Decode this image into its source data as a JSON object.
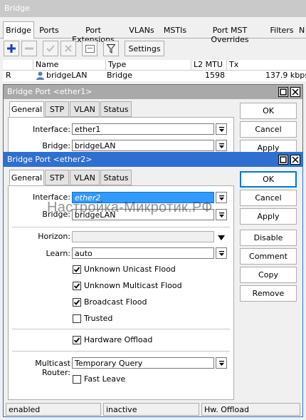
{
  "window": {
    "title": "Bridge"
  },
  "tabs": [
    "Bridge",
    "Ports",
    "Port Extensions",
    "VLANs",
    "MSTIs",
    "Port MST Overrides",
    "Filters",
    "N"
  ],
  "toolbar": {
    "settings_label": "Settings"
  },
  "table": {
    "headers": [
      "",
      "Name",
      "Type",
      "L2 MTU",
      "Tx"
    ],
    "rows": [
      {
        "flag": "R",
        "name": "bridgeLAN",
        "type": "Bridge",
        "l2mtu": "1598",
        "tx": "137.9 kbps"
      }
    ]
  },
  "dialog1": {
    "title": "Bridge Port <ether1>",
    "tabs": [
      "General",
      "STP",
      "VLAN",
      "Status"
    ],
    "interface_label": "Interface:",
    "interface_value": "ether1",
    "bridge_label": "Bridge:",
    "bridge_value": "bridgeLAN",
    "buttons": [
      "OK",
      "Cancel",
      "Apply"
    ]
  },
  "dialog2": {
    "title": "Bridge Port <ether2>",
    "tabs": [
      "General",
      "STP",
      "VLAN",
      "Status"
    ],
    "interface_label": "Interface:",
    "interface_value": "ether2",
    "bridge_label": "Bridge:",
    "bridge_value": "bridgeLAN",
    "horizon_label": "Horizon:",
    "horizon_value": "",
    "learn_label": "Learn:",
    "learn_value": "auto",
    "unknown_unicast_flood": {
      "label": "Unknown Unicast Flood",
      "checked": true
    },
    "unknown_multicast_flood": {
      "label": "Unknown Multicast Flood",
      "checked": true
    },
    "broadcast_flood": {
      "label": "Broadcast Flood",
      "checked": true
    },
    "trusted": {
      "label": "Trusted",
      "checked": false
    },
    "hardware_offload": {
      "label": "Hardware Offload",
      "checked": true
    },
    "multicast_router_label": "Multicast Router:",
    "multicast_router_value": "Temporary Query",
    "fast_leave": {
      "label": "Fast Leave",
      "checked": false
    },
    "buttons": [
      "OK",
      "Cancel",
      "Apply",
      "Disable",
      "Comment",
      "Copy",
      "Remove"
    ],
    "status": [
      "enabled",
      "inactive",
      "Hw. Offload"
    ]
  },
  "watermark": "Настройка-Микротик.РФ",
  "colors": {
    "active_title": "#2f6fd0",
    "inactive_title": "#a9a9a9",
    "selection": "#3399ff"
  }
}
